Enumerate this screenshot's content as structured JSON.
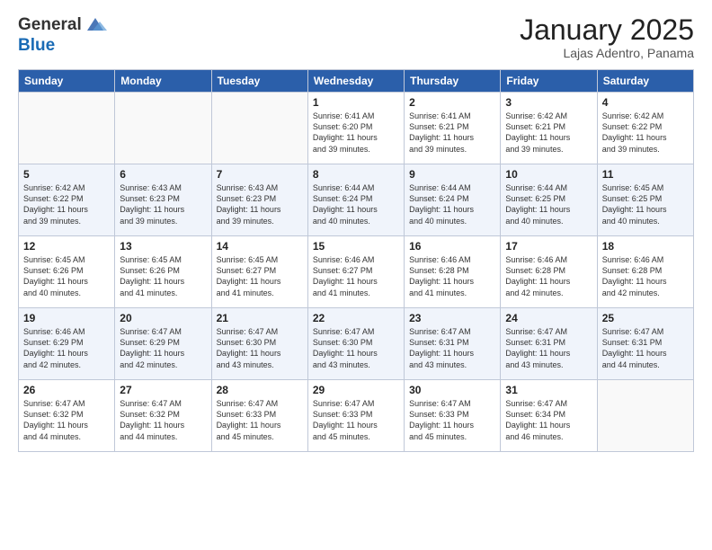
{
  "header": {
    "logo_line1": "General",
    "logo_line2": "Blue",
    "month_title": "January 2025",
    "location": "Lajas Adentro, Panama"
  },
  "weekdays": [
    "Sunday",
    "Monday",
    "Tuesday",
    "Wednesday",
    "Thursday",
    "Friday",
    "Saturday"
  ],
  "weeks": [
    [
      {
        "day": "",
        "info": ""
      },
      {
        "day": "",
        "info": ""
      },
      {
        "day": "",
        "info": ""
      },
      {
        "day": "1",
        "info": "Sunrise: 6:41 AM\nSunset: 6:20 PM\nDaylight: 11 hours\nand 39 minutes."
      },
      {
        "day": "2",
        "info": "Sunrise: 6:41 AM\nSunset: 6:21 PM\nDaylight: 11 hours\nand 39 minutes."
      },
      {
        "day": "3",
        "info": "Sunrise: 6:42 AM\nSunset: 6:21 PM\nDaylight: 11 hours\nand 39 minutes."
      },
      {
        "day": "4",
        "info": "Sunrise: 6:42 AM\nSunset: 6:22 PM\nDaylight: 11 hours\nand 39 minutes."
      }
    ],
    [
      {
        "day": "5",
        "info": "Sunrise: 6:42 AM\nSunset: 6:22 PM\nDaylight: 11 hours\nand 39 minutes."
      },
      {
        "day": "6",
        "info": "Sunrise: 6:43 AM\nSunset: 6:23 PM\nDaylight: 11 hours\nand 39 minutes."
      },
      {
        "day": "7",
        "info": "Sunrise: 6:43 AM\nSunset: 6:23 PM\nDaylight: 11 hours\nand 39 minutes."
      },
      {
        "day": "8",
        "info": "Sunrise: 6:44 AM\nSunset: 6:24 PM\nDaylight: 11 hours\nand 40 minutes."
      },
      {
        "day": "9",
        "info": "Sunrise: 6:44 AM\nSunset: 6:24 PM\nDaylight: 11 hours\nand 40 minutes."
      },
      {
        "day": "10",
        "info": "Sunrise: 6:44 AM\nSunset: 6:25 PM\nDaylight: 11 hours\nand 40 minutes."
      },
      {
        "day": "11",
        "info": "Sunrise: 6:45 AM\nSunset: 6:25 PM\nDaylight: 11 hours\nand 40 minutes."
      }
    ],
    [
      {
        "day": "12",
        "info": "Sunrise: 6:45 AM\nSunset: 6:26 PM\nDaylight: 11 hours\nand 40 minutes."
      },
      {
        "day": "13",
        "info": "Sunrise: 6:45 AM\nSunset: 6:26 PM\nDaylight: 11 hours\nand 41 minutes."
      },
      {
        "day": "14",
        "info": "Sunrise: 6:45 AM\nSunset: 6:27 PM\nDaylight: 11 hours\nand 41 minutes."
      },
      {
        "day": "15",
        "info": "Sunrise: 6:46 AM\nSunset: 6:27 PM\nDaylight: 11 hours\nand 41 minutes."
      },
      {
        "day": "16",
        "info": "Sunrise: 6:46 AM\nSunset: 6:28 PM\nDaylight: 11 hours\nand 41 minutes."
      },
      {
        "day": "17",
        "info": "Sunrise: 6:46 AM\nSunset: 6:28 PM\nDaylight: 11 hours\nand 42 minutes."
      },
      {
        "day": "18",
        "info": "Sunrise: 6:46 AM\nSunset: 6:28 PM\nDaylight: 11 hours\nand 42 minutes."
      }
    ],
    [
      {
        "day": "19",
        "info": "Sunrise: 6:46 AM\nSunset: 6:29 PM\nDaylight: 11 hours\nand 42 minutes."
      },
      {
        "day": "20",
        "info": "Sunrise: 6:47 AM\nSunset: 6:29 PM\nDaylight: 11 hours\nand 42 minutes."
      },
      {
        "day": "21",
        "info": "Sunrise: 6:47 AM\nSunset: 6:30 PM\nDaylight: 11 hours\nand 43 minutes."
      },
      {
        "day": "22",
        "info": "Sunrise: 6:47 AM\nSunset: 6:30 PM\nDaylight: 11 hours\nand 43 minutes."
      },
      {
        "day": "23",
        "info": "Sunrise: 6:47 AM\nSunset: 6:31 PM\nDaylight: 11 hours\nand 43 minutes."
      },
      {
        "day": "24",
        "info": "Sunrise: 6:47 AM\nSunset: 6:31 PM\nDaylight: 11 hours\nand 43 minutes."
      },
      {
        "day": "25",
        "info": "Sunrise: 6:47 AM\nSunset: 6:31 PM\nDaylight: 11 hours\nand 44 minutes."
      }
    ],
    [
      {
        "day": "26",
        "info": "Sunrise: 6:47 AM\nSunset: 6:32 PM\nDaylight: 11 hours\nand 44 minutes."
      },
      {
        "day": "27",
        "info": "Sunrise: 6:47 AM\nSunset: 6:32 PM\nDaylight: 11 hours\nand 44 minutes."
      },
      {
        "day": "28",
        "info": "Sunrise: 6:47 AM\nSunset: 6:33 PM\nDaylight: 11 hours\nand 45 minutes."
      },
      {
        "day": "29",
        "info": "Sunrise: 6:47 AM\nSunset: 6:33 PM\nDaylight: 11 hours\nand 45 minutes."
      },
      {
        "day": "30",
        "info": "Sunrise: 6:47 AM\nSunset: 6:33 PM\nDaylight: 11 hours\nand 45 minutes."
      },
      {
        "day": "31",
        "info": "Sunrise: 6:47 AM\nSunset: 6:34 PM\nDaylight: 11 hours\nand 46 minutes."
      },
      {
        "day": "",
        "info": ""
      }
    ]
  ]
}
